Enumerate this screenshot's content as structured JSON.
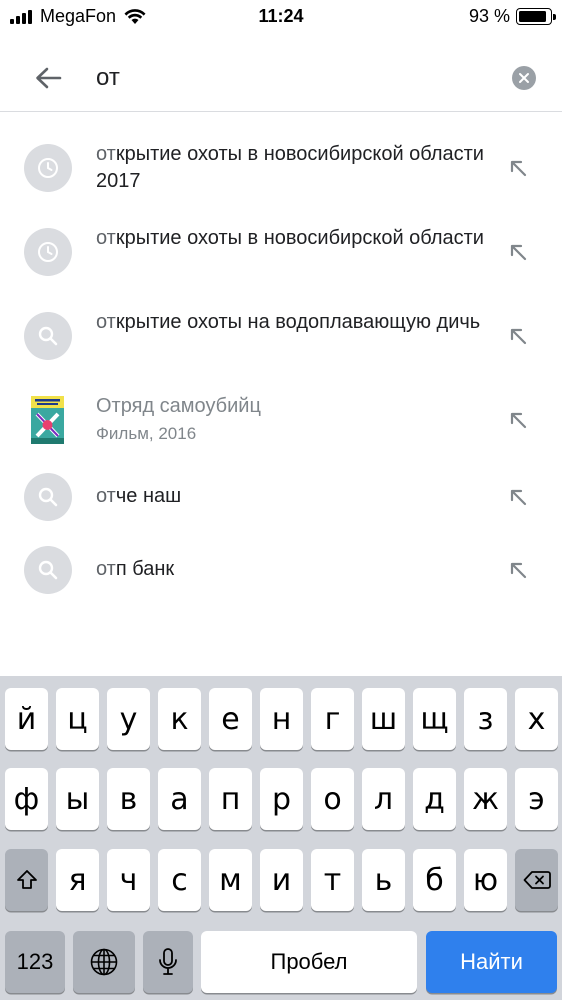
{
  "status_bar": {
    "carrier": "MegaFon",
    "time": "11:24",
    "battery_text": "93 %",
    "battery_level": 0.93
  },
  "search": {
    "query": "от"
  },
  "suggestions": [
    {
      "typed": "от",
      "rest": "крытие охоты в новосибирской области 2017",
      "icon": "history-clock-icon"
    },
    {
      "typed": "от",
      "rest": "крытие охоты в новосибирской области",
      "icon": "history-clock-icon"
    },
    {
      "typed": "от",
      "rest": "крытие охоты на водоплавающую дичь",
      "icon": "search-icon"
    },
    {
      "title": "Отряд самоубийц",
      "subtitle": "Фильм, 2016",
      "icon": "movie-poster-thumbnail"
    },
    {
      "typed": "от",
      "rest": "че наш",
      "icon": "search-icon"
    },
    {
      "typed": "от",
      "rest": "п банк",
      "icon": "search-icon"
    }
  ],
  "keyboard": {
    "row1": [
      "й",
      "ц",
      "у",
      "к",
      "е",
      "н",
      "г",
      "ш",
      "щ",
      "з",
      "х"
    ],
    "row2": [
      "ф",
      "ы",
      "в",
      "а",
      "п",
      "р",
      "о",
      "л",
      "д",
      "ж",
      "э"
    ],
    "row3": [
      "я",
      "ч",
      "с",
      "м",
      "и",
      "т",
      "ь",
      "б",
      "ю"
    ],
    "numbers_label": "123",
    "space_label": "Пробел",
    "go_label": "Найти",
    "shift_icon": "shift-icon",
    "backspace_icon": "backspace-icon",
    "globe_icon": "globe-icon",
    "mic_icon": "microphone-icon"
  },
  "colors": {
    "accent": "#2f80ed",
    "icon_bg": "#dadce0",
    "keyboard_bg": "#d2d5db"
  }
}
